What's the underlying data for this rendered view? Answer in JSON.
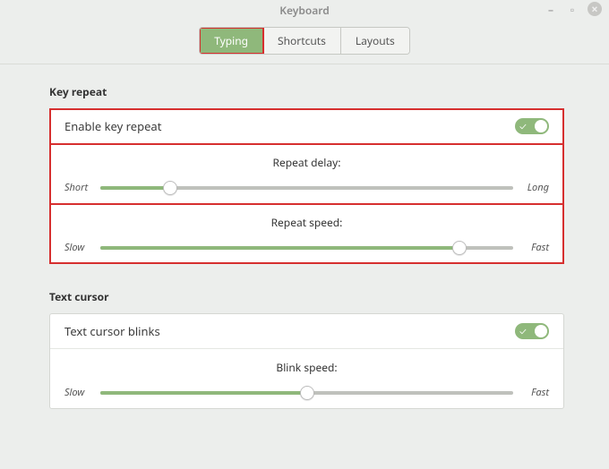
{
  "window": {
    "title": "Keyboard"
  },
  "tabs": {
    "typing": "Typing",
    "shortcuts": "Shortcuts",
    "layouts": "Layouts"
  },
  "key_repeat": {
    "header": "Key repeat",
    "enable_label": "Enable key repeat",
    "enabled": true,
    "delay": {
      "label": "Repeat delay:",
      "min_label": "Short",
      "max_label": "Long",
      "value_pct": 17
    },
    "speed": {
      "label": "Repeat speed:",
      "min_label": "Slow",
      "max_label": "Fast",
      "value_pct": 87
    }
  },
  "text_cursor": {
    "header": "Text cursor",
    "blinks_label": "Text cursor blinks",
    "blinks_enabled": true,
    "blink_speed": {
      "label": "Blink speed:",
      "min_label": "Slow",
      "max_label": "Fast",
      "value_pct": 50
    }
  }
}
